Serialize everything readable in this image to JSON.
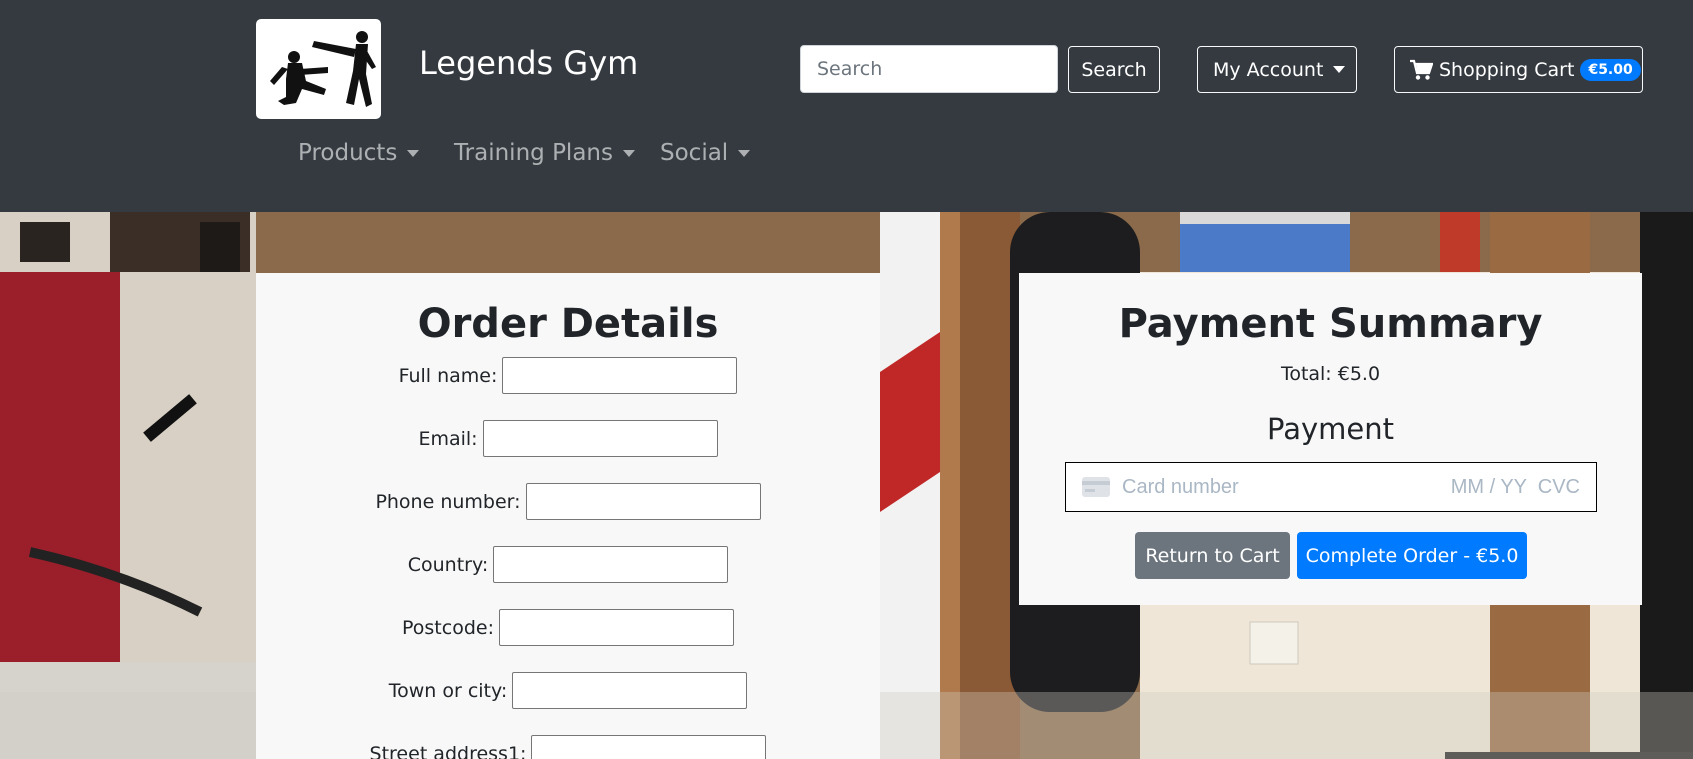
{
  "brand": {
    "name": "Legends Gym",
    "logo_icon": "martial-arts-silhouette-icon"
  },
  "search": {
    "placeholder": "Search",
    "button_label": "Search"
  },
  "account": {
    "label": "My Account"
  },
  "cart": {
    "label": "Shopping Cart",
    "badge": "€5.00",
    "icon": "cart-icon"
  },
  "nav": {
    "items": [
      {
        "label": "Products"
      },
      {
        "label": "Training Plans"
      },
      {
        "label": "Social"
      }
    ]
  },
  "order": {
    "title": "Order Details",
    "fields": [
      {
        "label": "Full name:"
      },
      {
        "label": "Email:"
      },
      {
        "label": "Phone number:"
      },
      {
        "label": "Country:"
      },
      {
        "label": "Postcode:"
      },
      {
        "label": "Town or city:"
      },
      {
        "label": "Street address1:"
      }
    ]
  },
  "payment": {
    "title": "Payment Summary",
    "total": "Total: €5.0",
    "heading": "Payment",
    "card_number_placeholder": "Card number",
    "expiry_cvc_placeholder": "MM / YY  CVC",
    "return_label": "Return to Cart",
    "complete_label": "Complete Order - €5.0"
  },
  "colors": {
    "navbar": "#343a40",
    "primary": "#007bff",
    "secondary": "#6c757d",
    "card": "#f8f8f8"
  }
}
